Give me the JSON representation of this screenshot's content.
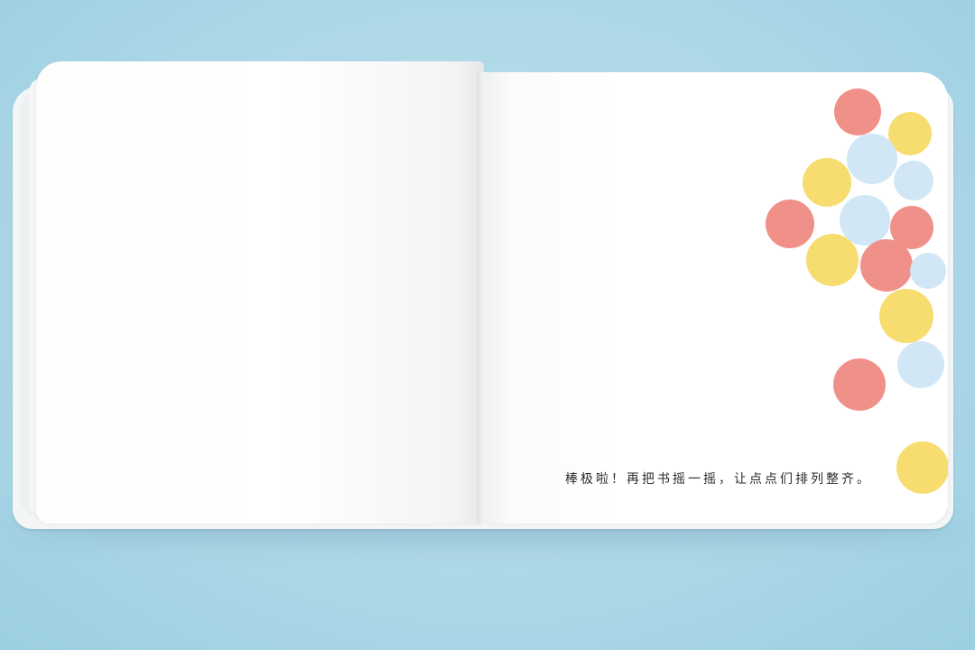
{
  "caption": "棒极啦！再把书摇一摇，让点点们排列整齐。",
  "colors": {
    "background": "#acd7e7",
    "page": "#ffffff",
    "dot_red": "#ef8c84",
    "dot_yellow": "#f7dc6a",
    "dot_blue": "#cfe6f6",
    "tab_red": "#d91d22",
    "tab_yellow": "#f1c40f",
    "tab_blue": "#bfe0f2"
  },
  "tabs": [
    {
      "color": "red"
    },
    {
      "color": "yellow"
    },
    {
      "color": "blue"
    },
    {
      "color": "yellow"
    },
    {
      "color": "red"
    },
    {
      "color": "yellow"
    }
  ],
  "dots": [
    {
      "color": "red"
    },
    {
      "color": "yellow"
    },
    {
      "color": "blue"
    },
    {
      "color": "yellow"
    },
    {
      "color": "blue"
    },
    {
      "color": "red"
    },
    {
      "color": "blue"
    },
    {
      "color": "red"
    },
    {
      "color": "yellow"
    },
    {
      "color": "red"
    },
    {
      "color": "blue"
    },
    {
      "color": "yellow"
    },
    {
      "color": "blue"
    },
    {
      "color": "red"
    },
    {
      "color": "yellow"
    }
  ]
}
